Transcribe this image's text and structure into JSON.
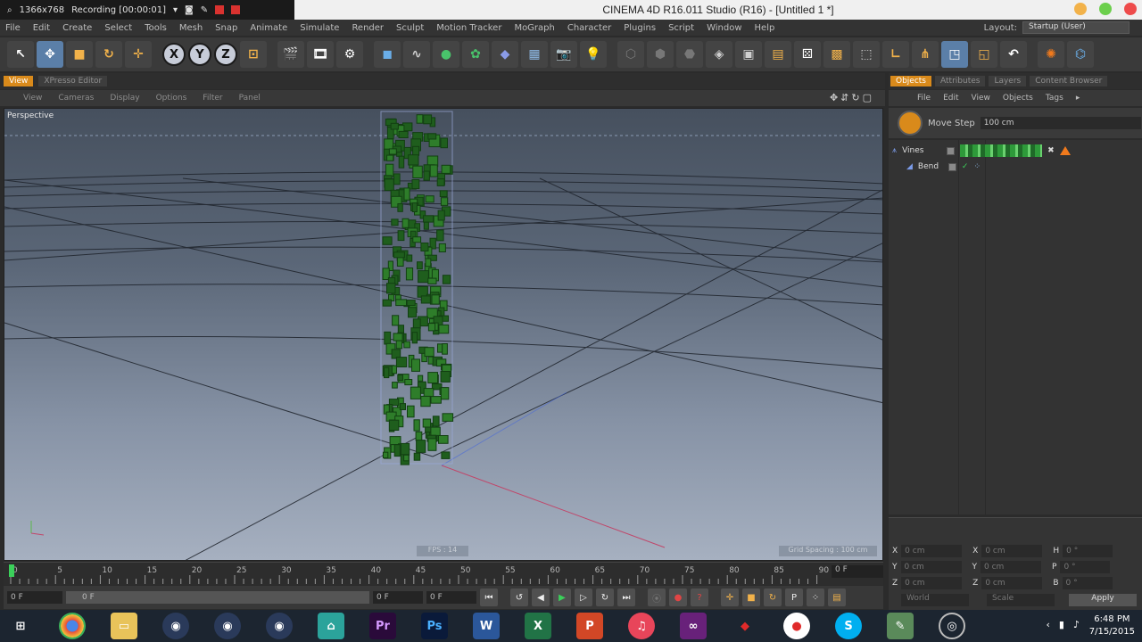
{
  "recorder": {
    "resolution": "1366x768",
    "status": "Recording [00:00:01]"
  },
  "window": {
    "title": "CINEMA 4D R16.011 Studio (R16) - [Untitled 1 *]"
  },
  "menu": [
    "File",
    "Edit",
    "Create",
    "Select",
    "Tools",
    "Mesh",
    "Snap",
    "Animate",
    "Simulate",
    "Render",
    "Sculpt",
    "Motion Tracker",
    "MoGraph",
    "Character",
    "Plugins",
    "Script",
    "Window",
    "Help"
  ],
  "layout": {
    "label": "Layout:",
    "value": "Startup (User)"
  },
  "axes": {
    "x": "X",
    "y": "Y",
    "z": "Z"
  },
  "view_tabs": [
    "View",
    "XPresso Editor"
  ],
  "view_menu": [
    "View",
    "Cameras",
    "Display",
    "Options",
    "Filter",
    "Panel"
  ],
  "viewport": {
    "label": "Perspective",
    "fps": "FPS : 14",
    "grid_spacing": "Grid Spacing : 100 cm"
  },
  "timeline": {
    "ticks": [
      "0",
      "5",
      "10",
      "15",
      "20",
      "25",
      "30",
      "35",
      "40",
      "45",
      "50",
      "55",
      "60",
      "65",
      "70",
      "75",
      "80",
      "85",
      "90"
    ],
    "end_field": "0 F",
    "start_field": "0 F",
    "range_start": "0 F",
    "range_end": "0 F",
    "max_field": "0 F"
  },
  "right_tabs": [
    "Objects",
    "Attributes",
    "Layers",
    "Content Browser"
  ],
  "right_menu": [
    "File",
    "Edit",
    "View",
    "Objects",
    "Tags"
  ],
  "move_step": {
    "label": "Move Step",
    "value": "100 cm"
  },
  "objects": [
    {
      "name": "Vines"
    },
    {
      "name": "Bend"
    }
  ],
  "coords": {
    "rows": [
      {
        "a": "X",
        "av": "0 cm",
        "b": "X",
        "bv": "0 cm",
        "c": "H",
        "cv": "0 °"
      },
      {
        "a": "Y",
        "av": "0 cm",
        "b": "Y",
        "bv": "0 cm",
        "c": "P",
        "cv": "0 °"
      },
      {
        "a": "Z",
        "av": "0 cm",
        "b": "Z",
        "bv": "0 cm",
        "c": "B",
        "cv": "0 °"
      }
    ],
    "mode1": "World",
    "mode2": "Scale",
    "apply": "Apply"
  },
  "taskbar": {
    "time": "6:48 PM",
    "date": "7/15/2015"
  },
  "colors": {
    "accent": "#d98a1b",
    "vines": "#2e7d2a",
    "active_tool": "#5b7fa8"
  }
}
